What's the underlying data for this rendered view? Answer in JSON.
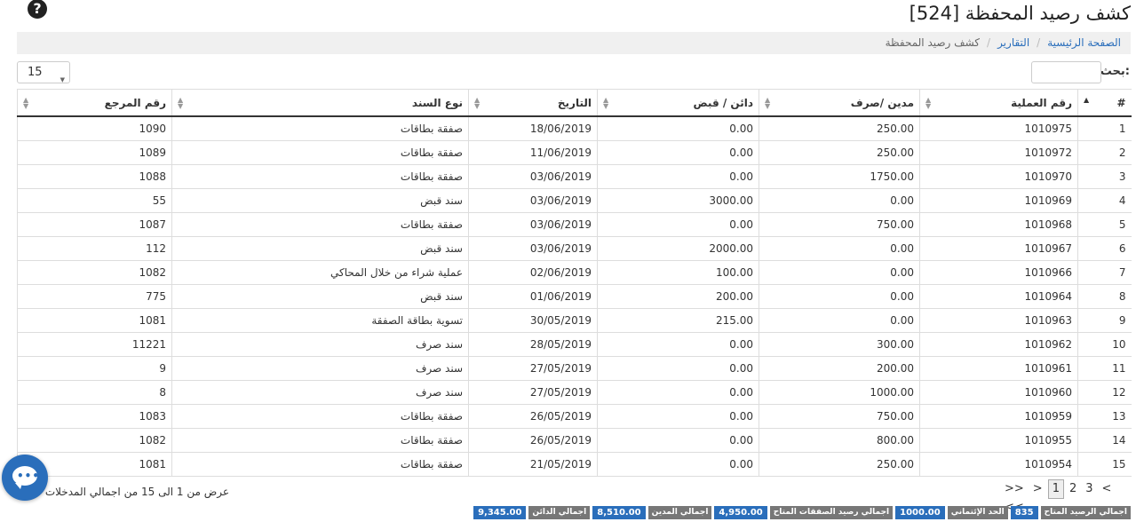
{
  "page": {
    "title": "كشف رصيد المحفظة [524]",
    "help_glyph": "?"
  },
  "breadcrumb": {
    "home": "الصفحة الرئيسية",
    "reports": "التقارير",
    "current": "كشف رصيد المحفظة"
  },
  "controls": {
    "page_size": "15",
    "search_label": ":بحث",
    "search_value": ""
  },
  "table": {
    "headers": [
      "#",
      "رقم العملية",
      "مدين /صرف",
      "دائن / قبض",
      "التاريخ",
      "نوع السند",
      "رقم المرجع"
    ],
    "rows": [
      [
        "1",
        "1010975",
        "250.00",
        "0.00",
        "18/06/2019",
        "صفقة بطاقات",
        "1090"
      ],
      [
        "2",
        "1010972",
        "250.00",
        "0.00",
        "11/06/2019",
        "صفقة بطاقات",
        "1089"
      ],
      [
        "3",
        "1010970",
        "1750.00",
        "0.00",
        "03/06/2019",
        "صفقة بطاقات",
        "1088"
      ],
      [
        "4",
        "1010969",
        "0.00",
        "3000.00",
        "03/06/2019",
        "سند قبض",
        "55"
      ],
      [
        "5",
        "1010968",
        "750.00",
        "0.00",
        "03/06/2019",
        "صفقة بطاقات",
        "1087"
      ],
      [
        "6",
        "1010967",
        "0.00",
        "2000.00",
        "03/06/2019",
        "سند قبض",
        "112"
      ],
      [
        "7",
        "1010966",
        "0.00",
        "100.00",
        "02/06/2019",
        "عملية شراء من خلال المحاكي",
        "1082"
      ],
      [
        "8",
        "1010964",
        "0.00",
        "200.00",
        "01/06/2019",
        "سند قبض",
        "775"
      ],
      [
        "9",
        "1010963",
        "0.00",
        "215.00",
        "30/05/2019",
        "تسوية بطاقة الصفقة",
        "1081"
      ],
      [
        "10",
        "1010962",
        "300.00",
        "0.00",
        "28/05/2019",
        "سند صرف",
        "11221"
      ],
      [
        "11",
        "1010961",
        "200.00",
        "0.00",
        "27/05/2019",
        "سند صرف",
        "9"
      ],
      [
        "12",
        "1010960",
        "1000.00",
        "0.00",
        "27/05/2019",
        "سند صرف",
        "8"
      ],
      [
        "13",
        "1010959",
        "750.00",
        "0.00",
        "26/05/2019",
        "صفقة بطاقات",
        "1083"
      ],
      [
        "14",
        "1010955",
        "800.00",
        "0.00",
        "26/05/2019",
        "صفقة بطاقات",
        "1082"
      ],
      [
        "15",
        "1010954",
        "250.00",
        "0.00",
        "21/05/2019",
        "صفقة بطاقات",
        "1081"
      ]
    ]
  },
  "info": {
    "text": "عرض من 1 الى 15 من اجمالي المدخلات"
  },
  "pagination": {
    "items": [
      ">>",
      ">",
      "1",
      "2",
      "3",
      "<",
      "<<"
    ],
    "current": "1"
  },
  "footer": {
    "items": [
      {
        "label": "اجمالي الرصيد المتاح",
        "value": "835"
      },
      {
        "label": "الحد الإئتماني",
        "value": "1000.00"
      },
      {
        "label": "اجمالي رصيد الصفقات المتاح",
        "value": "4,950.00"
      },
      {
        "label": "اجمالي المدين",
        "value": "8,510.00"
      },
      {
        "label": "اجمالي الدائن",
        "value": "9,345.00"
      }
    ]
  },
  "colors": {
    "accent": "#2a6ebb",
    "label_bg": "#777777"
  },
  "icons": {
    "help": "question-circle-icon",
    "chat": "chat-bubble-icon",
    "sort": "sort-arrows-icon",
    "caret": "chevron-down-icon"
  }
}
